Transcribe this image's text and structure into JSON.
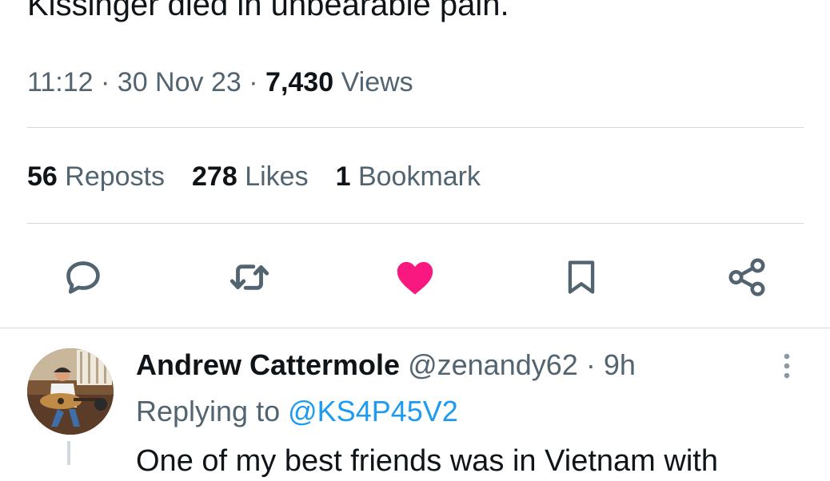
{
  "tweet": {
    "text": "Kissinger died in unbearable pain.",
    "time": "11:12",
    "date": "30 Nov 23",
    "views_count": "7,430",
    "views_label": "Views",
    "sep": "·"
  },
  "stats": {
    "reposts_count": "56",
    "reposts_label": "Reposts",
    "likes_count": "278",
    "likes_label": "Likes",
    "bookmarks_count": "1",
    "bookmarks_label": "Bookmark"
  },
  "actions": {
    "reply_icon": "reply-icon",
    "repost_icon": "repost-icon",
    "like_icon": "heart-icon",
    "bookmark_icon": "bookmark-icon",
    "share_icon": "share-icon",
    "like_color": "#f91880"
  },
  "reply": {
    "name": "Andrew Cattermole",
    "handle": "@zenandy62",
    "sep": "·",
    "age": "9h",
    "replying_prefix": "Replying to",
    "replying_to": "@KS4P45V2",
    "text": "One of my best friends was in Vietnam with"
  },
  "colors": {
    "primary_text": "#0f1419",
    "secondary_text": "#536471",
    "link": "#1d9bf0",
    "divider": "#cfd9de"
  }
}
